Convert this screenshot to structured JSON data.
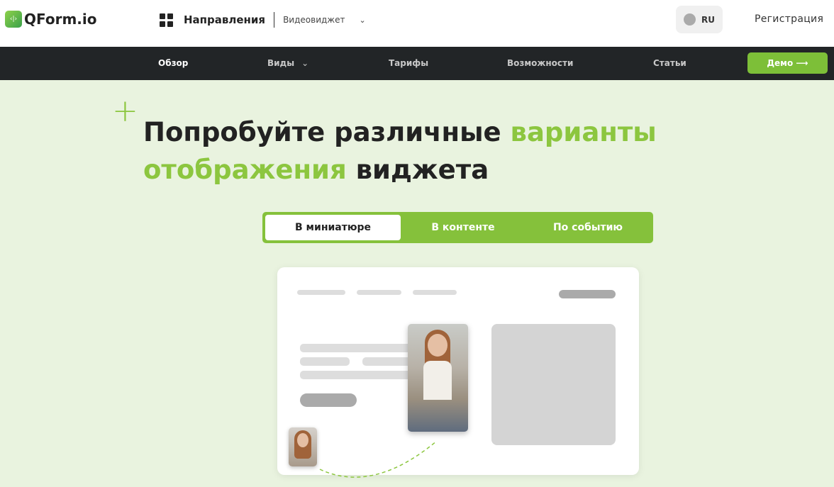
{
  "header": {
    "logo": "QForm.io",
    "directions": "Направления",
    "product": "Видеовиджет",
    "lang": "RU",
    "register": "Регистрация"
  },
  "nav": {
    "items": [
      "Обзор",
      "Виды",
      "Тарифы",
      "Возможности",
      "Статьи"
    ],
    "demo": "Демо ⟶"
  },
  "hero": {
    "title_1": "Попробуйте различные ",
    "title_2": "варианты",
    "title_3": "отображения",
    "title_4": " виджета"
  },
  "tabs": [
    "В миниатюре",
    "В контенте",
    "По событию"
  ],
  "colors": {
    "accent": "#8cc63f",
    "nav_bg": "#222527",
    "page_bg": "#e9f3df"
  }
}
